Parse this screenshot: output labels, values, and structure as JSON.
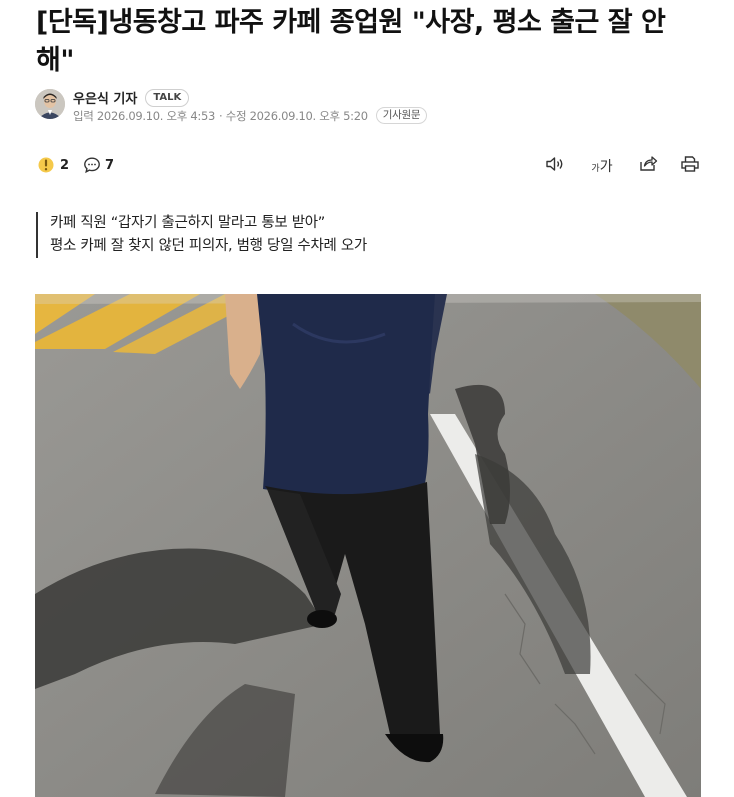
{
  "article": {
    "title": "[단독]냉동창고 파주 카페 종업원 \"사장, 평소 출근 잘 안 해\"",
    "author": "우은식 기자",
    "talk_badge": "TALK",
    "published": "입력 2026.09.10. 오후 4:53",
    "modified": "· 수정 2026.09.10. 오후 5:20",
    "source_button": "기사원문",
    "reactions": {
      "like_count": "2",
      "comment_count": "7"
    },
    "tools": {
      "font_size_label_small": "가",
      "font_size_label_large": "가"
    },
    "summary": [
      "카페 직원 “갑자기 출근하지 말라고 통보 받아”",
      "평소 카페 잘 찾지 않던 피의자, 범행 당일 수차례 오가"
    ]
  },
  "colors": {
    "text": "#111111",
    "meta": "#888888",
    "asphalt": "#8b8a86",
    "crosswalk": "#e6b640",
    "shirt": "#1f2a4a",
    "pants": "#1a1a1a"
  },
  "icons": [
    "like-icon",
    "comment-icon",
    "audio-icon",
    "font-size-icon",
    "share-icon",
    "print-icon"
  ]
}
